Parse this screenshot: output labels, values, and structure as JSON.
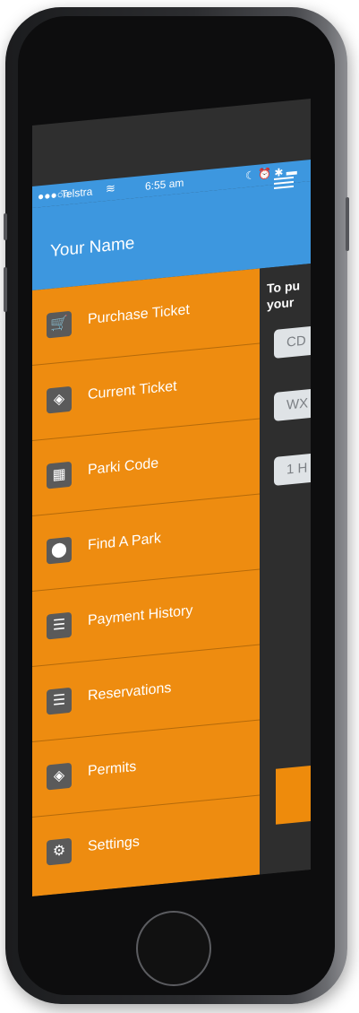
{
  "status_bar": {
    "carrier": "Telstra",
    "time": "6:55 am"
  },
  "header": {
    "user_name": "Your Name"
  },
  "menu": [
    {
      "label": "Purchase Ticket",
      "icon": "cart-icon"
    },
    {
      "label": "Current Ticket",
      "icon": "ticket-icon"
    },
    {
      "label": "Parki Code",
      "icon": "qr-code-icon"
    },
    {
      "label": "Find A Park",
      "icon": "map-pin-icon"
    },
    {
      "label": "Payment History",
      "icon": "document-icon"
    },
    {
      "label": "Reservations",
      "icon": "document-icon"
    },
    {
      "label": "Permits",
      "icon": "ticket-icon"
    },
    {
      "label": "Settings",
      "icon": "gear-icon"
    }
  ],
  "panel": {
    "line1": "To pu",
    "line2": "your",
    "field1": "CD",
    "field2": "WX",
    "field3": "1 H"
  },
  "colors": {
    "header_blue": "#3d97df",
    "menu_orange": "#ee8c10",
    "icon_gray": "#5a5a5a"
  }
}
